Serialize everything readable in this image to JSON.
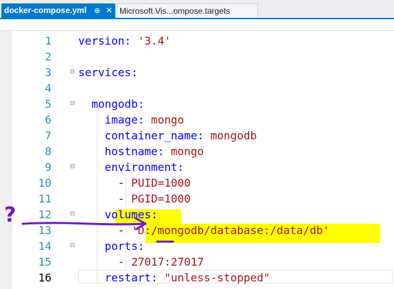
{
  "tabs": [
    {
      "label": "docker-compose.yml",
      "active": true
    },
    {
      "label": "Microsoft.Vis...ompose.targets",
      "active": false
    }
  ],
  "tab_icons": {
    "pin": "⊕",
    "close": "✕"
  },
  "editor": {
    "current_line": 16,
    "lines": [
      {
        "n": "1",
        "parts": [
          {
            "t": "version: ",
            "c": "k"
          },
          {
            "t": "'3.4'",
            "c": "s"
          }
        ]
      },
      {
        "n": "2",
        "parts": []
      },
      {
        "n": "3",
        "fold": true,
        "parts": [
          {
            "t": "services:",
            "c": "k"
          }
        ]
      },
      {
        "n": "4",
        "parts": []
      },
      {
        "n": "5",
        "fold": true,
        "parts": [
          {
            "t": "  mongodb:",
            "c": "k"
          }
        ]
      },
      {
        "n": "6",
        "parts": [
          {
            "t": "    image: ",
            "c": "k"
          },
          {
            "t": "mongo",
            "c": "s"
          }
        ]
      },
      {
        "n": "7",
        "parts": [
          {
            "t": "    container_name: ",
            "c": "k"
          },
          {
            "t": "mongodb",
            "c": "s"
          }
        ]
      },
      {
        "n": "8",
        "parts": [
          {
            "t": "    hostname: ",
            "c": "k"
          },
          {
            "t": "mongo",
            "c": "s"
          }
        ]
      },
      {
        "n": "9",
        "fold": true,
        "parts": [
          {
            "t": "    environment:",
            "c": "k"
          }
        ]
      },
      {
        "n": "10",
        "parts": [
          {
            "t": "      - ",
            "c": "p"
          },
          {
            "t": "PUID=1000",
            "c": "s"
          }
        ]
      },
      {
        "n": "11",
        "parts": [
          {
            "t": "      - ",
            "c": "p"
          },
          {
            "t": "PGID=1000",
            "c": "s"
          }
        ]
      },
      {
        "n": "12",
        "fold": true,
        "parts": [
          {
            "t": "    volumes:",
            "c": "k"
          }
        ]
      },
      {
        "n": "13",
        "parts": [
          {
            "t": "      - ",
            "c": "p"
          },
          {
            "t": "'D:/mongodb/database:/data/db'",
            "c": "s"
          }
        ]
      },
      {
        "n": "14",
        "fold": true,
        "parts": [
          {
            "t": "    ports:",
            "c": "k"
          }
        ]
      },
      {
        "n": "15",
        "parts": [
          {
            "t": "      - ",
            "c": "p"
          },
          {
            "t": "27017:27017",
            "c": "s"
          }
        ]
      },
      {
        "n": "16",
        "parts": [
          {
            "t": "    restart: ",
            "c": "k"
          },
          {
            "t": "\"unless-stopped\"",
            "c": "s"
          }
        ]
      }
    ]
  },
  "annotations": {
    "question_mark": "?",
    "highlight_color": "#ffff00",
    "pen_color": "#6a1cc7"
  },
  "colors": {
    "keyword": "#0000ff",
    "string": "#a31515",
    "line_number": "#2b91af",
    "tab_active": "#007acc"
  }
}
